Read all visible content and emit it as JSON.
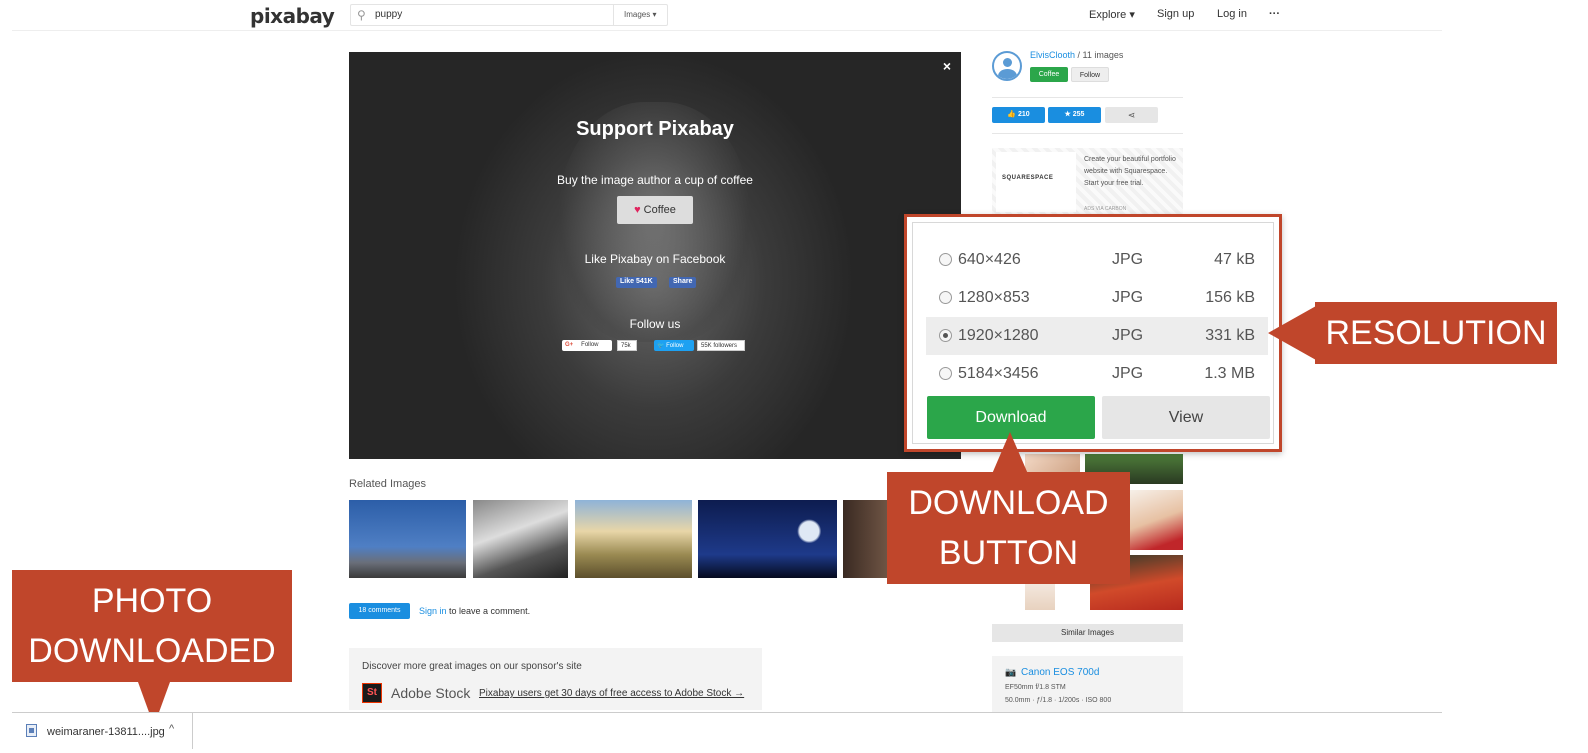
{
  "header": {
    "logo": "pixabay",
    "search_value": "puppy",
    "search_filter": "Images ▾",
    "nav": [
      "Explore ▾",
      "Sign up",
      "Log in",
      "···"
    ]
  },
  "hero": {
    "close": "×",
    "title": "Support Pixabay",
    "coffee_prompt": "Buy the image author a cup of coffee",
    "coffee_button": "Coffee",
    "facebook_prompt": "Like Pixabay on Facebook",
    "fb_like": "Like 541K",
    "fb_share": "Share",
    "follow_prompt": "Follow us",
    "google_follow": "Follow",
    "google_count": "75k",
    "twitter_follow": "Follow",
    "twitter_count": "55K followers"
  },
  "related": {
    "title": "Related Images"
  },
  "comments": {
    "badge": "18 comments",
    "signin": "Sign in",
    "suffix": " to leave a comment."
  },
  "sponsor": {
    "headline": "Discover more great images on our sponsor's site",
    "logo_text": "St",
    "name": "Adobe Stock",
    "link": "Pixabay users get 30 days of free access to Adobe Stock →"
  },
  "author": {
    "name": "ElvisClooth",
    "count": " / 11 images",
    "coffee": "Coffee",
    "follow": "Follow"
  },
  "stats": {
    "likes": "210",
    "favorites": "255",
    "share_icon": "share-icon"
  },
  "ad": {
    "brand": "SQUARESPACE",
    "text": "Create your beautiful portfolio website with Squarespace. Start your free trial.",
    "via": "ADS VIA CARBON"
  },
  "similar": {
    "label": "Similar Images"
  },
  "camera": {
    "model": "Canon EOS 700d",
    "lens": "EF50mm f/1.8 STM",
    "exposure": "50.0mm · ƒ/1.8 · 1/200s · ISO 800"
  },
  "popup": {
    "rows": [
      {
        "dim": "640×426",
        "fmt": "JPG",
        "size": "47 kB"
      },
      {
        "dim": "1280×853",
        "fmt": "JPG",
        "size": "156 kB"
      },
      {
        "dim": "1920×1280",
        "fmt": "JPG",
        "size": "331 kB"
      },
      {
        "dim": "5184×3456",
        "fmt": "JPG",
        "size": "1.3 MB"
      }
    ],
    "selected": "1920×1280",
    "download": "Download",
    "view": "View"
  },
  "callouts": {
    "resolution": "RESOLUTION",
    "download_button": [
      "DOWNLOAD",
      "BUTTON"
    ],
    "photo_downloaded": [
      "PHOTO",
      "DOWNLOADED"
    ]
  },
  "shelf": {
    "filename": "weimaraner-13811....jpg",
    "chevron": "^"
  },
  "colors": {
    "callout": "#c0462b",
    "green": "#2ba64a",
    "blue": "#1a8ee0"
  }
}
